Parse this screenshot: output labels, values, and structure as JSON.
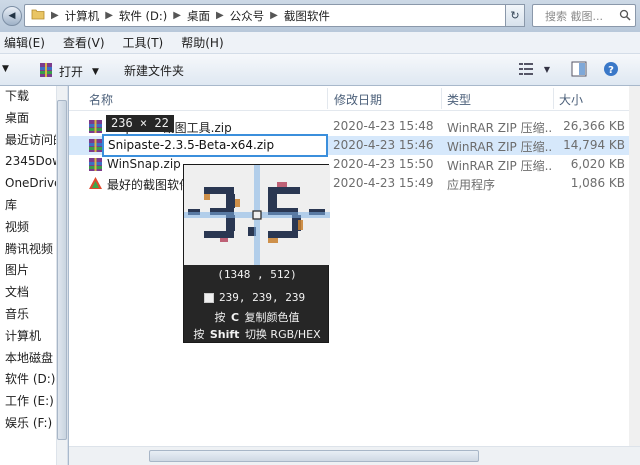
{
  "address": {
    "crumbs": [
      "计算机",
      "软件 (D:)",
      "桌面",
      "公众号",
      "截图软件"
    ],
    "search_placeholder": "搜索 截图..."
  },
  "menu": [
    "编辑(E)",
    "查看(V)",
    "工具(T)",
    "帮助(H)"
  ],
  "toolbar": {
    "open_label": "打开",
    "newfolder_label": "新建文件夹"
  },
  "nav": [
    "下载",
    "桌面",
    "最近访问的",
    "2345Dow",
    "OneDrive",
    "库",
    "视频",
    "腾讯视频",
    "图片",
    "文档",
    "音乐",
    "计算机",
    "本地磁盘",
    "软件 (D:)",
    "工作 (E:)",
    "娱乐 (F:)"
  ],
  "columns": {
    "name": "名称",
    "date": "修改日期",
    "type": "类型",
    "size": "大小"
  },
  "files": [
    {
      "name": "Snipaste 截图工具.zip",
      "date": "2020-4-23 15:48",
      "type": "WinRAR ZIP 压缩...",
      "size": "26,366 KB",
      "icon": "winrar-zip-icon"
    },
    {
      "name": "Snipaste-2.3.5-Beta-x64.zip",
      "date": "2020-4-23 15:46",
      "type": "WinRAR ZIP 压缩...",
      "size": "14,794 KB",
      "icon": "winrar-zip-icon"
    },
    {
      "name": "WinSnap.zip",
      "date": "2020-4-23 15:50",
      "type": "WinRAR ZIP 压缩...",
      "size": "6,020 KB",
      "icon": "winrar-zip-icon"
    },
    {
      "name": "最好的截图软件.exe",
      "date": "2020-4-23 15:49",
      "type": "应用程序",
      "size": "1,086 KB",
      "icon": "app-exe-icon"
    }
  ],
  "rename_value": "Snipaste-2.3.5-Beta-x64.zip",
  "snipaste": {
    "size_badge": "236 × 22",
    "coords": "(1348 , 512)",
    "rgb": "239, 239, 239",
    "hint_copy_prefix": "按",
    "hint_copy_key": "C",
    "hint_copy_text": "复制颜色值",
    "hint_switch_prefix": "按",
    "hint_switch_key": "Shift",
    "hint_switch_text": "切换 RGB/HEX",
    "swatch_color": "#efefef"
  }
}
